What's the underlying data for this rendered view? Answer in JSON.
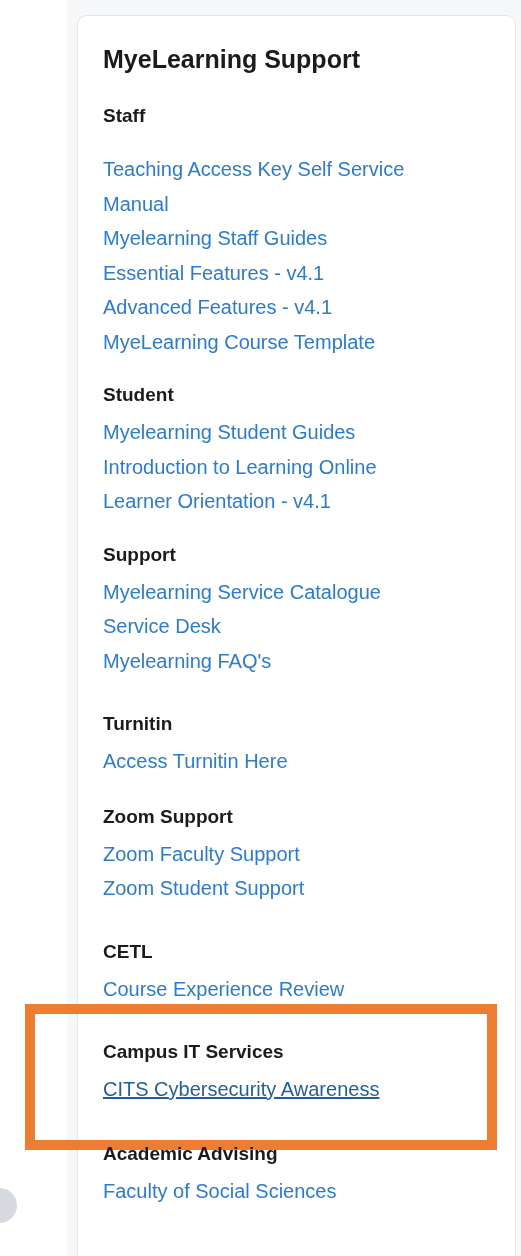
{
  "panel": {
    "title": "MyeLearning Support",
    "sections": [
      {
        "heading": "Staff",
        "highlighted": false,
        "links": [
          {
            "label": "Teaching Access Key Self Service",
            "hovered": false
          },
          {
            "label": "Manual",
            "hovered": false
          },
          {
            "label": "Myelearning Staff Guides",
            "hovered": false
          },
          {
            "label": "Essential Features - v4.1",
            "hovered": false
          },
          {
            "label": "Advanced Features - v4.1",
            "hovered": false
          },
          {
            "label": "MyeLearning Course Template",
            "hovered": false
          }
        ]
      },
      {
        "heading": "Student",
        "highlighted": false,
        "links": [
          {
            "label": "Myelearning Student Guides",
            "hovered": false
          },
          {
            "label": "Introduction to Learning Online",
            "hovered": false
          },
          {
            "label": "Learner Orientation - v4.1",
            "hovered": false
          }
        ]
      },
      {
        "heading": "Support",
        "highlighted": false,
        "links": [
          {
            "label": "Myelearning Service Catalogue",
            "hovered": false
          },
          {
            "label": "Service Desk",
            "hovered": false
          },
          {
            "label": "Myelearning FAQ's",
            "hovered": false
          }
        ]
      },
      {
        "heading": "Turnitin",
        "highlighted": false,
        "links": [
          {
            "label": "Access Turnitin Here",
            "hovered": false
          }
        ]
      },
      {
        "heading": "Zoom Support",
        "highlighted": false,
        "links": [
          {
            "label": "Zoom Faculty Support",
            "hovered": false
          },
          {
            "label": "Zoom Student Support",
            "hovered": false
          }
        ]
      },
      {
        "heading": "CETL",
        "highlighted": false,
        "links": [
          {
            "label": "Course Experience Review",
            "hovered": false
          }
        ]
      },
      {
        "heading": "Campus IT Services",
        "highlighted": true,
        "links": [
          {
            "label": "CITS Cybersecurity Awareness",
            "hovered": true
          }
        ]
      },
      {
        "heading": "Academic Advising",
        "highlighted": false,
        "links": [
          {
            "label": "Faculty of Social Sciences",
            "hovered": false
          }
        ]
      }
    ]
  }
}
